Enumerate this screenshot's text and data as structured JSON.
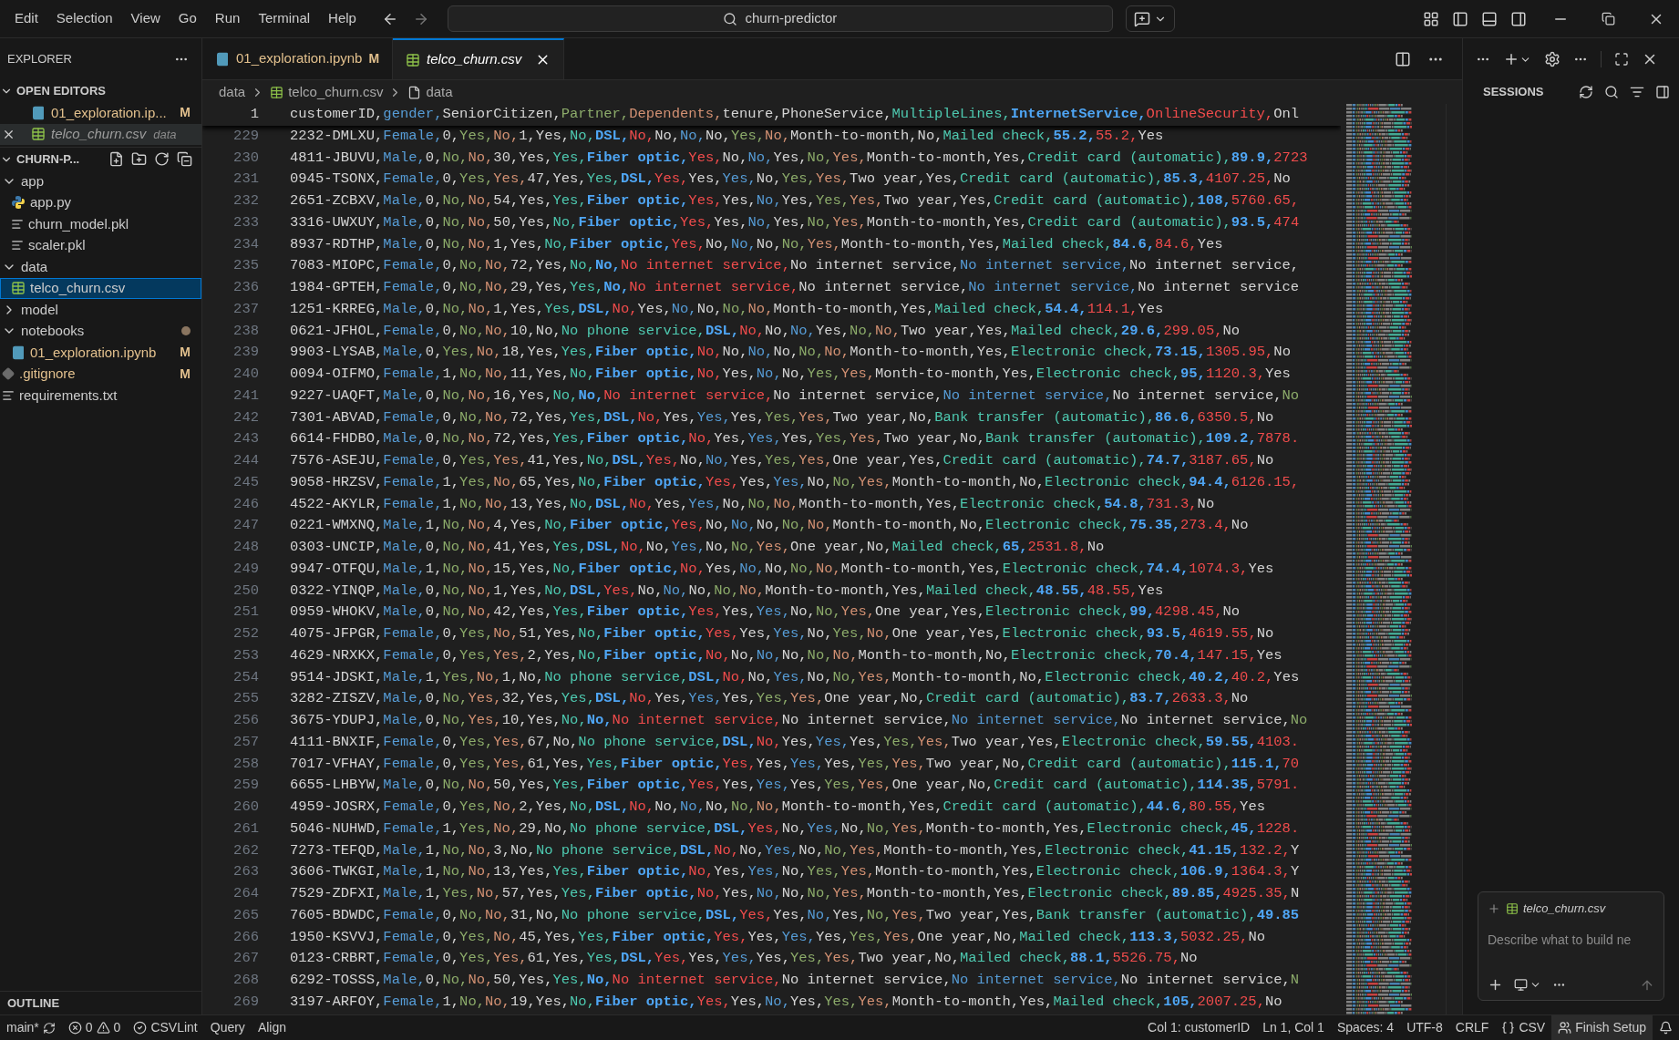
{
  "menu": [
    "Edit",
    "Selection",
    "View",
    "Go",
    "Run",
    "Terminal",
    "Help"
  ],
  "command_center": {
    "text": "churn-predictor"
  },
  "sidebar": {
    "title": "EXPLORER",
    "open_editors": {
      "title": "OPEN EDITORS",
      "items": [
        {
          "name": "01_exploration.ip...",
          "kind": "notebook",
          "badge": "M",
          "selected": false
        },
        {
          "name": "telco_churn.csv",
          "kind": "csv",
          "folder": "data",
          "selected": true
        }
      ]
    },
    "workspace": {
      "title": "CHURN-P...",
      "tree": [
        {
          "name": "app",
          "kind": "folder",
          "expanded": true,
          "selected": false,
          "children": [
            {
              "name": "app.py",
              "kind": "python",
              "selected": false
            },
            {
              "name": "churn_model.pkl",
              "kind": "text",
              "selected": false
            },
            {
              "name": "scaler.pkl",
              "kind": "text",
              "selected": false
            }
          ]
        },
        {
          "name": "data",
          "kind": "folder",
          "expanded": true,
          "selected": false,
          "children": [
            {
              "name": "telco_churn.csv",
              "kind": "csv",
              "selected": true
            }
          ]
        },
        {
          "name": "model",
          "kind": "folder",
          "expanded": false,
          "selected": false
        },
        {
          "name": "notebooks",
          "kind": "folder",
          "expanded": true,
          "selected": false,
          "modified": true,
          "children": [
            {
              "name": "01_exploration.ipynb",
              "kind": "notebook",
              "badge": "M",
              "selected": false
            }
          ]
        },
        {
          "name": ".gitignore",
          "kind": "git",
          "badge": "M",
          "selected": false
        },
        {
          "name": "requirements.txt",
          "kind": "text",
          "selected": false
        }
      ]
    },
    "outline": "OUTLINE"
  },
  "tabs": [
    {
      "label": "01_exploration.ipynb",
      "kind": "notebook",
      "badge": "M",
      "selected": false
    },
    {
      "label": "telco_churn.csv",
      "kind": "csv",
      "selected": true
    }
  ],
  "breadcrumb": [
    {
      "label": "data",
      "kind": "folder"
    },
    {
      "label": "telco_churn.csv",
      "kind": "csv"
    },
    {
      "label": "data",
      "kind": "symbol"
    }
  ],
  "editor": {
    "header": {
      "number": "1",
      "text": "customerID,gender,SeniorCitizen,Partner,Dependents,tenure,PhoneService,MultipleLines,InternetService,OnlineSecurity,Onl"
    },
    "lines": [
      {
        "number": "229",
        "text": "2232-DMLXU,Female,0,Yes,No,1,Yes,No,DSL,No,No,No,No,Yes,No,Month-to-month,No,Mailed check,55.2,55.2,Yes"
      },
      {
        "number": "230",
        "text": "4811-JBUVU,Male,0,No,No,30,Yes,Yes,Fiber optic,Yes,No,No,Yes,No,Yes,Month-to-month,Yes,Credit card (automatic),89.9,2723"
      },
      {
        "number": "231",
        "text": "0945-TSONX,Female,0,Yes,Yes,47,Yes,Yes,DSL,Yes,Yes,Yes,No,Yes,Yes,Two year,Yes,Credit card (automatic),85.3,4107.25,No"
      },
      {
        "number": "232",
        "text": "2651-ZCBXV,Male,0,No,No,54,Yes,Yes,Fiber optic,Yes,Yes,No,Yes,Yes,Yes,Two year,Yes,Credit card (automatic),108,5760.65,"
      },
      {
        "number": "233",
        "text": "3316-UWXUY,Male,0,No,No,50,Yes,No,Fiber optic,Yes,Yes,No,Yes,No,Yes,Month-to-month,Yes,Credit card (automatic),93.5,474"
      },
      {
        "number": "234",
        "text": "8937-RDTHP,Male,0,No,No,1,Yes,No,Fiber optic,Yes,No,No,No,No,Yes,Month-to-month,Yes,Mailed check,84.6,84.6,Yes"
      },
      {
        "number": "235",
        "text": "7083-MIOPC,Female,0,No,No,72,Yes,No,No,No internet service,No internet service,No internet service,No internet service,"
      },
      {
        "number": "236",
        "text": "1984-GPTEH,Female,0,No,No,29,Yes,Yes,No,No internet service,No internet service,No internet service,No internet service"
      },
      {
        "number": "237",
        "text": "1251-KRREG,Male,0,No,No,1,Yes,Yes,DSL,No,Yes,No,No,No,No,Month-to-month,Yes,Mailed check,54.4,114.1,Yes"
      },
      {
        "number": "238",
        "text": "0621-JFHOL,Female,0,No,No,10,No,No phone service,DSL,No,No,No,Yes,No,No,Two year,Yes,Mailed check,29.6,299.05,No"
      },
      {
        "number": "239",
        "text": "9903-LYSAB,Male,0,Yes,No,18,Yes,Yes,Fiber optic,No,No,No,No,No,No,Month-to-month,Yes,Electronic check,73.15,1305.95,No"
      },
      {
        "number": "240",
        "text": "0094-OIFMO,Female,1,No,No,11,Yes,No,Fiber optic,No,Yes,No,No,Yes,Yes,Month-to-month,Yes,Electronic check,95,1120.3,Yes"
      },
      {
        "number": "241",
        "text": "9227-UAQFT,Male,0,No,No,16,Yes,No,No,No internet service,No internet service,No internet service,No internet service,No"
      },
      {
        "number": "242",
        "text": "7301-ABVAD,Female,0,No,No,72,Yes,Yes,DSL,No,Yes,Yes,Yes,Yes,Yes,Two year,No,Bank transfer (automatic),86.6,6350.5,No"
      },
      {
        "number": "243",
        "text": "6614-FHDBO,Male,0,No,No,72,Yes,Yes,Fiber optic,No,Yes,Yes,Yes,Yes,Yes,Two year,No,Bank transfer (automatic),109.2,7878."
      },
      {
        "number": "244",
        "text": "7576-ASEJU,Female,0,Yes,Yes,41,Yes,No,DSL,Yes,No,No,Yes,Yes,Yes,One year,Yes,Credit card (automatic),74.7,3187.65,No"
      },
      {
        "number": "245",
        "text": "9058-HRZSV,Female,1,Yes,No,65,Yes,No,Fiber optic,Yes,Yes,Yes,No,No,Yes,Month-to-month,No,Electronic check,94.4,6126.15,"
      },
      {
        "number": "246",
        "text": "4522-AKYLR,Female,1,No,No,13,Yes,No,DSL,No,Yes,Yes,No,No,No,Month-to-month,Yes,Electronic check,54.8,731.3,No"
      },
      {
        "number": "247",
        "text": "0221-WMXNQ,Male,1,No,No,4,Yes,No,Fiber optic,Yes,No,No,No,No,No,Month-to-month,No,Electronic check,75.35,273.4,No"
      },
      {
        "number": "248",
        "text": "0303-UNCIP,Male,0,No,No,41,Yes,Yes,DSL,No,No,Yes,No,No,Yes,One year,No,Mailed check,65,2531.8,No"
      },
      {
        "number": "249",
        "text": "9947-OTFQU,Male,1,No,No,15,Yes,No,Fiber optic,No,Yes,No,No,No,No,Month-to-month,Yes,Electronic check,74.4,1074.3,Yes"
      },
      {
        "number": "250",
        "text": "0322-YINQP,Male,0,No,No,1,Yes,No,DSL,Yes,No,No,No,No,No,Month-to-month,Yes,Mailed check,48.55,48.55,Yes"
      },
      {
        "number": "251",
        "text": "0959-WHOKV,Male,0,No,No,42,Yes,Yes,Fiber optic,Yes,Yes,Yes,No,No,Yes,One year,Yes,Electronic check,99,4298.45,No"
      },
      {
        "number": "252",
        "text": "4075-JFPGR,Female,0,Yes,No,51,Yes,No,Fiber optic,Yes,Yes,Yes,No,Yes,No,One year,Yes,Electronic check,93.5,4619.55,No"
      },
      {
        "number": "253",
        "text": "4629-NRXKX,Female,0,Yes,Yes,2,Yes,No,Fiber optic,No,No,No,No,No,No,Month-to-month,No,Electronic check,70.4,147.15,Yes"
      },
      {
        "number": "254",
        "text": "9514-JDSKI,Male,1,Yes,No,1,No,No phone service,DSL,No,No,Yes,No,No,Yes,Month-to-month,No,Electronic check,40.2,40.2,Yes"
      },
      {
        "number": "255",
        "text": "3282-ZISZV,Male,0,No,Yes,32,Yes,Yes,DSL,No,Yes,Yes,Yes,Yes,Yes,One year,No,Credit card (automatic),83.7,2633.3,No"
      },
      {
        "number": "256",
        "text": "3675-YDUPJ,Male,0,No,Yes,10,Yes,No,No,No internet service,No internet service,No internet service,No internet service,No"
      },
      {
        "number": "257",
        "text": "4111-BNXIF,Female,0,Yes,Yes,67,No,No phone service,DSL,No,Yes,Yes,Yes,Yes,Yes,Two year,Yes,Electronic check,59.55,4103."
      },
      {
        "number": "258",
        "text": "7017-VFHAY,Female,0,Yes,Yes,61,Yes,Yes,Fiber optic,Yes,Yes,Yes,Yes,Yes,Yes,Two year,No,Credit card (automatic),115.1,70"
      },
      {
        "number": "259",
        "text": "6655-LHBYW,Male,0,No,No,50,Yes,Yes,Fiber optic,Yes,Yes,Yes,Yes,Yes,Yes,One year,No,Credit card (automatic),114.35,5791."
      },
      {
        "number": "260",
        "text": "4959-JOSRX,Female,0,Yes,No,2,Yes,No,DSL,No,No,No,No,No,No,Month-to-month,Yes,Credit card (automatic),44.6,80.55,Yes"
      },
      {
        "number": "261",
        "text": "5046-NUHWD,Female,1,Yes,No,29,No,No phone service,DSL,Yes,No,Yes,No,No,Yes,Month-to-month,Yes,Electronic check,45,1228."
      },
      {
        "number": "262",
        "text": "7273-TEFQD,Male,1,No,No,3,No,No phone service,DSL,No,No,Yes,No,No,Yes,Month-to-month,Yes,Electronic check,41.15,132.2,Y"
      },
      {
        "number": "263",
        "text": "3606-TWKGI,Male,1,No,No,13,Yes,Yes,Fiber optic,No,Yes,Yes,No,Yes,Yes,Month-to-month,Yes,Electronic check,106.9,1364.3,Y"
      },
      {
        "number": "264",
        "text": "7529-ZDFXI,Male,1,Yes,No,57,Yes,Yes,Fiber optic,No,Yes,No,No,No,Yes,Month-to-month,Yes,Electronic check,89.85,4925.35,N"
      },
      {
        "number": "265",
        "text": "7605-BDWDC,Female,0,No,No,31,No,No phone service,DSL,Yes,Yes,No,Yes,No,Yes,Two year,Yes,Bank transfer (automatic),49.85"
      },
      {
        "number": "266",
        "text": "1950-KSVVJ,Female,0,Yes,No,45,Yes,Yes,Fiber optic,Yes,Yes,Yes,Yes,Yes,Yes,One year,No,Mailed check,113.3,5032.25,No"
      },
      {
        "number": "267",
        "text": "0123-CRBRT,Female,0,Yes,Yes,61,Yes,Yes,DSL,Yes,Yes,Yes,Yes,Yes,Yes,Two year,No,Mailed check,88.1,5526.75,No"
      },
      {
        "number": "268",
        "text": "6292-TOSSS,Male,0,No,No,50,Yes,Yes,No,No internet service,No internet service,No internet service,No internet service,N"
      },
      {
        "number": "269",
        "text": "3197-ARFOY,Female,1,No,No,19,Yes,No,Fiber optic,Yes,Yes,No,Yes,Yes,Yes,Month-to-month,Yes,Mailed check,105,2007.25,No"
      }
    ]
  },
  "right_panel": {
    "title": "SESSIONS",
    "chat": {
      "attachment": "telco_churn.csv",
      "placeholder": "Describe what to build ne"
    }
  },
  "status_bar": {
    "left": [
      {
        "kind": "branch",
        "text": "main*"
      },
      {
        "kind": "problems",
        "errors": "0",
        "warnings": "0"
      },
      {
        "kind": "lint",
        "text": "CSVLint"
      },
      {
        "kind": "text",
        "text": "Query"
      },
      {
        "kind": "text",
        "text": "Align"
      }
    ],
    "right": [
      {
        "kind": "text",
        "text": "Col 1: customerID"
      },
      {
        "kind": "text",
        "text": "Ln 1, Col 1"
      },
      {
        "kind": "text",
        "text": "Spaces: 4"
      },
      {
        "kind": "text",
        "text": "UTF-8"
      },
      {
        "kind": "text",
        "text": "CRLF"
      },
      {
        "kind": "language",
        "text": "CSV"
      },
      {
        "kind": "setup",
        "text": "Finish Setup"
      },
      {
        "kind": "bell"
      }
    ]
  }
}
